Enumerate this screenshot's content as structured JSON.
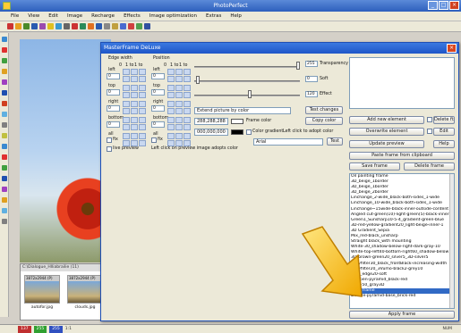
{
  "app": {
    "title": "PhotoPerfect",
    "menu": [
      "File",
      "View",
      "Edit",
      "Image",
      "Recharge",
      "Effects",
      "Image optimization",
      "Extras",
      "Help"
    ]
  },
  "explorer": {
    "path": "C:\\Dialogue_Hlliabrailie (11)",
    "thumbs": [
      {
        "label": "3872x2944 (P)",
        "name": "autofor.jpg"
      },
      {
        "label": "3872x2944 (P)",
        "name": "clouds.jpg"
      }
    ]
  },
  "statusbar": {
    "cells": [
      "137",
      "255",
      "255",
      "1:1"
    ],
    "right": "NUM"
  },
  "dialog": {
    "title": "MasterFrame DeLuxe",
    "close": "×",
    "edge_width_label": "Edge width",
    "position_label": "Position",
    "scale": [
      "0",
      "1 to",
      "1 to"
    ],
    "scale2": [
      "0",
      "1 to",
      "1 to"
    ],
    "left_label": "left",
    "top_label": "top",
    "right_label": "right",
    "bottom_label": "bottom",
    "all_label": "all",
    "fix_label": "fix",
    "fields": {
      "left": "0",
      "top": "0",
      "right": "0",
      "bottom": "0",
      "pleft": "0",
      "ptop": "0",
      "pright": "0",
      "pbottom": "0"
    },
    "transparency_value": "255",
    "transparency_label": "Transparency",
    "soft_value": "0",
    "soft_label": "Soft",
    "effect_value": "120",
    "effect_label": "Effect",
    "extend_select": "Extend picture by color",
    "test_changes": "Test changes",
    "color1": "288,288,288",
    "frame_color": "Frame color",
    "copy_color": "Copy color",
    "color2": "000,000,000",
    "color_gradient": "Color gradient",
    "left_click_adopt": "Left click to adopt color",
    "font_select": "Arial",
    "test_btn": "Test",
    "live_preview": "live preview",
    "left_click_hint": "Left click on preview image adopts color",
    "add_new_element": "Add new element",
    "delete_fix": "Delete fix",
    "overwrite_element": "Overwrite element",
    "edit": "Edit",
    "update_preview": "Update preview",
    "help": "Help",
    "paste_frame": "Paste frame from clipboard",
    "save_frame": "Save frame",
    "delete_frame": "Delete frame",
    "apply_frame": "Apply frame",
    "frames": [
      "Oil painting frame",
      "3D_beige_1border",
      "3D_beige_1border",
      "3D_beige_2border",
      "Linchange_2-wide_black-both-sides_1-wide",
      "Linchange_10-wide_black-both-sides_1-wide",
      "Linchange~15wide-black-inner-outside-content",
      "Angled cut-green(10)-light-green(5)-black-inner",
      "Green1_Sunsharp10-5-4_gradient-green-blue",
      "3D-red-yellow-gradient20_light-beige-inner-1",
      "3D Gradient_Sepia",
      "Mix_red-black_unsharp",
      "Straight black_with mounting",
      "White-30_shadow-below-right-dark-gray-10",
      "White-top-left40-bottom-right60_shadow-below",
      "3D-brown-green20_silver5_3D-silver5",
      "Greyfilter30_black_frontBlack-increasing-width",
      "Greyfilter20_3Vumo-black2-grey10",
      "light_edge20-soft",
      "sharpen-pyramid_black-red",
      "wide-50_gray3D",
      "Wide frame",
      "Double-pyramid-base_brick-red"
    ],
    "selected_frame_index": 21
  }
}
